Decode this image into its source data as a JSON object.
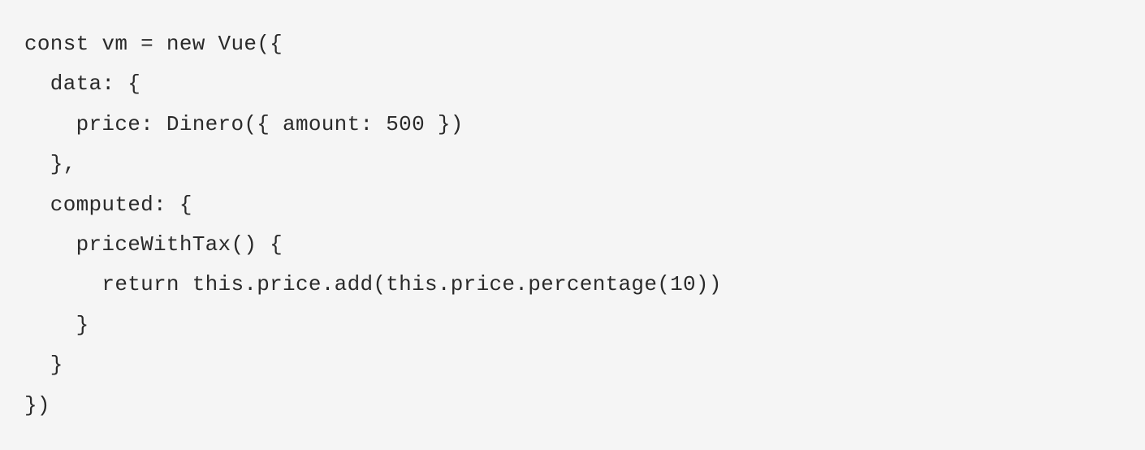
{
  "code": {
    "line1": "const vm = new Vue({",
    "line2": "  data: {",
    "line3": "    price: Dinero({ amount: 500 })",
    "line4": "  },",
    "line5": "  computed: {",
    "line6": "    priceWithTax() {",
    "line7": "      return this.price.add(this.price.percentage(10))",
    "line8": "    }",
    "line9": "  }",
    "line10": "})"
  }
}
